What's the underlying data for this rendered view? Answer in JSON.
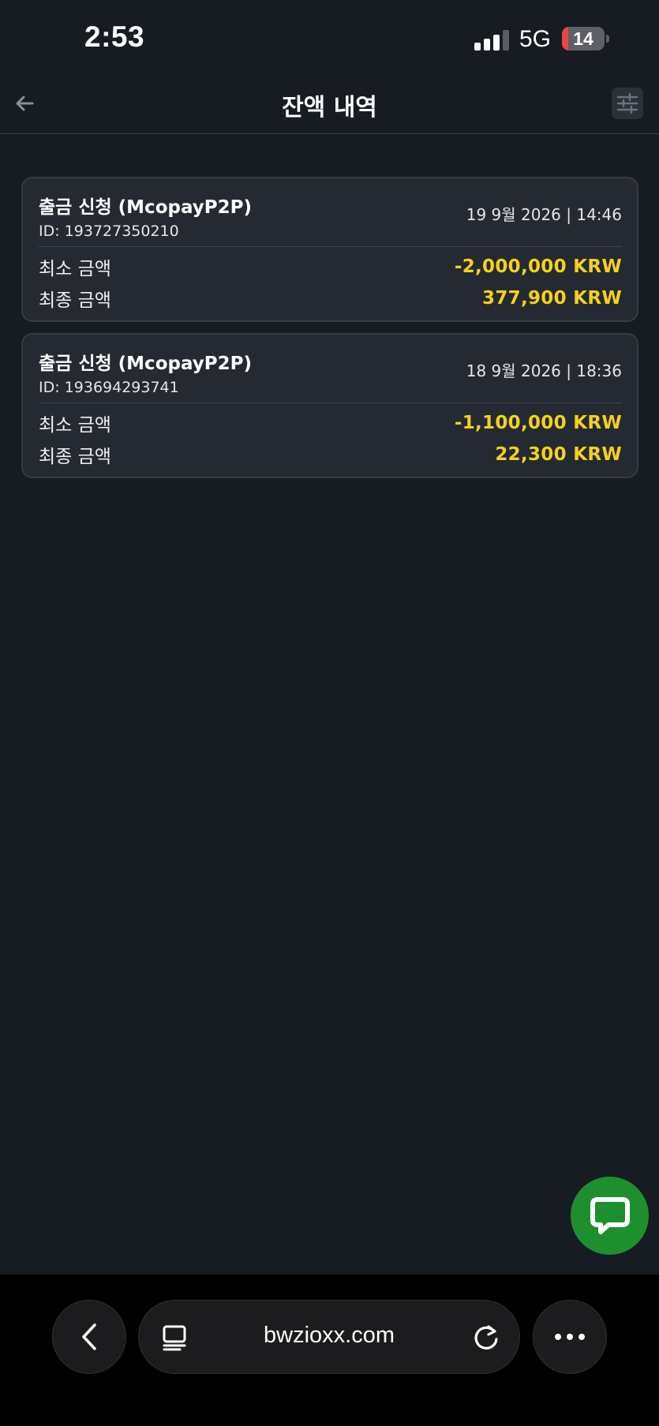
{
  "status_bar": {
    "time": "2:53",
    "network": "5G",
    "battery_level": "14",
    "battery_fraction": 0.14,
    "signal_bars_active": 3,
    "signal_bars_total": 4
  },
  "header": {
    "title": "잔액 내역",
    "back_icon": "arrow-left-icon",
    "filter_icon": "sliders-icon"
  },
  "transactions": [
    {
      "title": "출금 신청 (McopayP2P)",
      "id": "ID: 193727350210",
      "datetime": "19 9월 2026 | 14:46",
      "min_label": "최소 금액",
      "min_amount": "-2,000,000 KRW",
      "final_label": "최종 금액",
      "final_amount": "377,900 KRW"
    },
    {
      "title": "출금 신청 (McopayP2P)",
      "id": "ID: 193694293741",
      "datetime": "18 9월 2026 | 18:36",
      "min_label": "최소 금액",
      "min_amount": "-1,100,000 KRW",
      "final_label": "최종 금액",
      "final_amount": "22,300 KRW"
    }
  ],
  "chat": {
    "icon": "chat-bubble-icon"
  },
  "browser": {
    "url": "bwzioxx.com",
    "back_icon": "chevron-left-icon",
    "tabs_icon": "tabs-icon",
    "reload_icon": "reload-icon",
    "more_icon": "more-dots-icon"
  },
  "colors": {
    "background": "#171b22",
    "card": "#252a32",
    "amount": "#f4d21c",
    "chat_fab": "#1e8f2f",
    "battery_low": "#eb4545"
  }
}
